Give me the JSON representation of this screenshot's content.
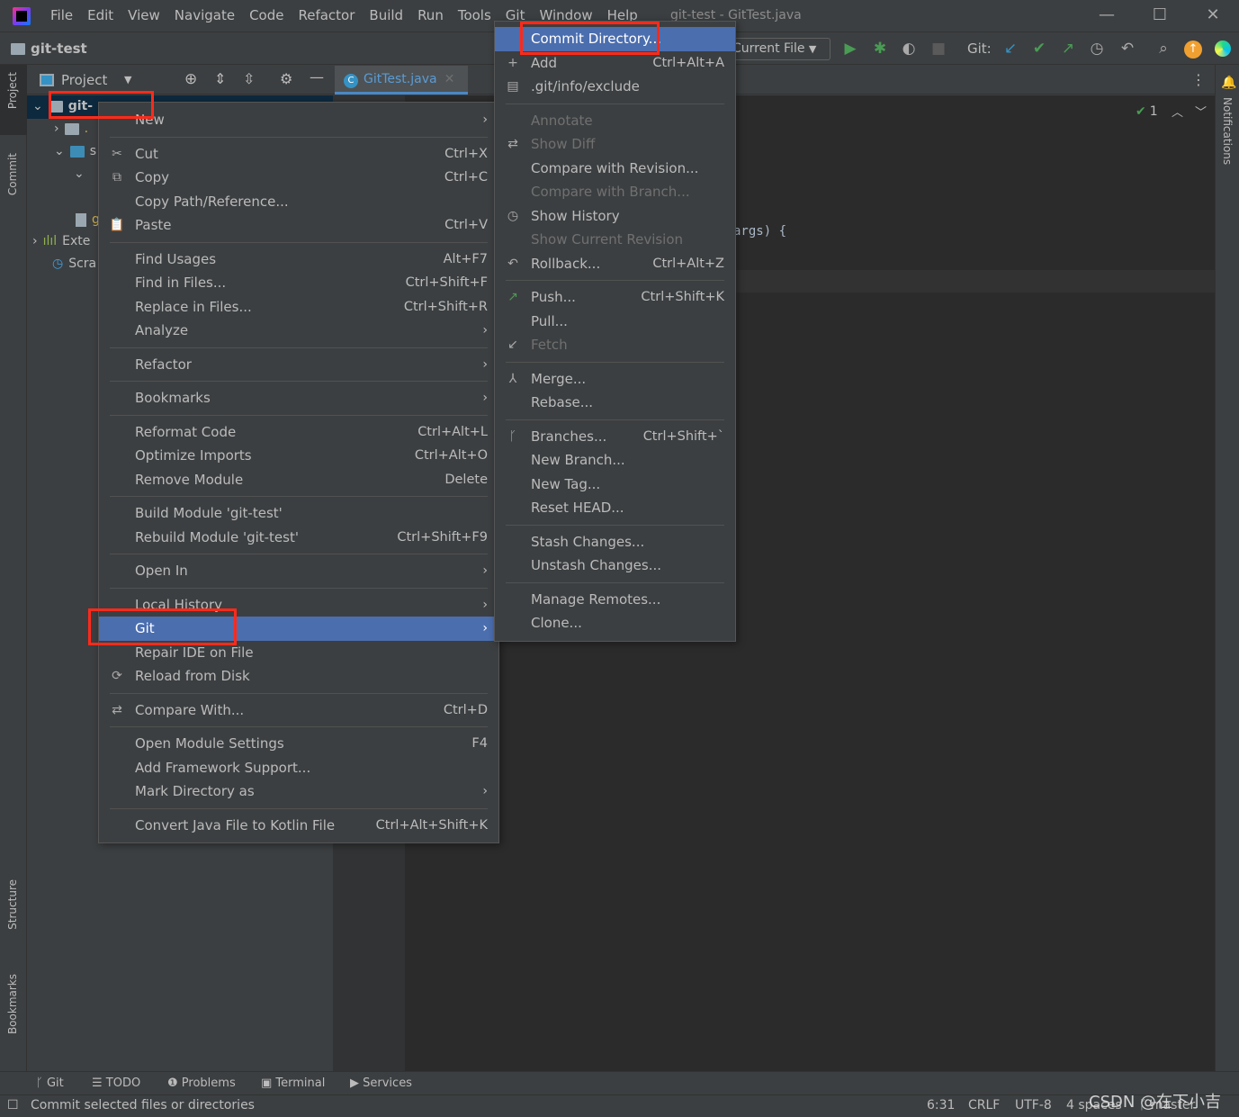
{
  "titlebar": {
    "menus": [
      "File",
      "Edit",
      "View",
      "Navigate",
      "Code",
      "Refactor",
      "Build",
      "Run",
      "Tools",
      "Git",
      "Window",
      "Help"
    ],
    "title": "git-test - GitTest.java"
  },
  "navbar": {
    "project": "git-test",
    "run_config": "Current File",
    "git_label": "Git:"
  },
  "left_strip": {
    "project": "Project",
    "commit": "Commit",
    "structure": "Structure",
    "bookmarks": "Bookmarks"
  },
  "right_strip": {
    "notifications": "Notifications"
  },
  "project_panel": {
    "title": "Project",
    "tree": [
      {
        "label": "git-"
      },
      {
        "label": "."
      },
      {
        "label": "s"
      },
      {
        "label": ""
      },
      {
        "label": "g"
      },
      {
        "label": "Exte"
      },
      {
        "label": "Scra"
      }
    ]
  },
  "editor": {
    "tab": "GitTest.java",
    "code_fragment": "args) {",
    "inspection_count": "1"
  },
  "context_menu": [
    {
      "label": "New",
      "arrow": true
    },
    {
      "sep": true
    },
    {
      "label": "Cut",
      "shortcut": "Ctrl+X",
      "icon": "✂",
      "iconName": "scissors-icon"
    },
    {
      "label": "Copy",
      "shortcut": "Ctrl+C",
      "icon": "⧉",
      "iconName": "copy-icon"
    },
    {
      "label": "Copy Path/Reference..."
    },
    {
      "label": "Paste",
      "shortcut": "Ctrl+V",
      "icon": "📋",
      "iconName": "clipboard-icon"
    },
    {
      "sep": true
    },
    {
      "label": "Find Usages",
      "shortcut": "Alt+F7"
    },
    {
      "label": "Find in Files...",
      "shortcut": "Ctrl+Shift+F"
    },
    {
      "label": "Replace in Files...",
      "shortcut": "Ctrl+Shift+R"
    },
    {
      "label": "Analyze",
      "arrow": true
    },
    {
      "sep": true
    },
    {
      "label": "Refactor",
      "arrow": true
    },
    {
      "sep": true
    },
    {
      "label": "Bookmarks",
      "arrow": true
    },
    {
      "sep": true
    },
    {
      "label": "Reformat Code",
      "shortcut": "Ctrl+Alt+L"
    },
    {
      "label": "Optimize Imports",
      "shortcut": "Ctrl+Alt+O"
    },
    {
      "label": "Remove Module",
      "shortcut": "Delete"
    },
    {
      "sep": true
    },
    {
      "label": "Build Module 'git-test'"
    },
    {
      "label": "Rebuild Module 'git-test'",
      "shortcut": "Ctrl+Shift+F9"
    },
    {
      "sep": true
    },
    {
      "label": "Open In",
      "arrow": true
    },
    {
      "sep": true
    },
    {
      "label": "Local History",
      "arrow": true
    },
    {
      "label": "Git",
      "arrow": true,
      "selected": true
    },
    {
      "label": "Repair IDE on File"
    },
    {
      "label": "Reload from Disk",
      "icon": "⟳",
      "iconName": "reload-icon"
    },
    {
      "sep": true
    },
    {
      "label": "Compare With...",
      "shortcut": "Ctrl+D",
      "icon": "⇄",
      "iconName": "compare-icon"
    },
    {
      "sep": true
    },
    {
      "label": "Open Module Settings",
      "shortcut": "F4"
    },
    {
      "label": "Add Framework Support..."
    },
    {
      "label": "Mark Directory as",
      "arrow": true
    },
    {
      "sep": true
    },
    {
      "label": "Convert Java File to Kotlin File",
      "shortcut": "Ctrl+Alt+Shift+K"
    }
  ],
  "git_menu": [
    {
      "label": "Commit Directory...",
      "selected": true
    },
    {
      "label": "Add",
      "shortcut": "Ctrl+Alt+A",
      "icon": "+",
      "iconName": "plus-icon"
    },
    {
      "label": ".git/info/exclude",
      "icon": "▤",
      "iconName": "exclude-file-icon"
    },
    {
      "sep": true
    },
    {
      "label": "Annotate",
      "disabled": true
    },
    {
      "label": "Show Diff",
      "disabled": true,
      "icon": "⇄",
      "iconName": "diff-icon"
    },
    {
      "label": "Compare with Revision..."
    },
    {
      "label": "Compare with Branch...",
      "disabled": true
    },
    {
      "label": "Show History",
      "icon": "◷",
      "iconName": "clock-icon"
    },
    {
      "label": "Show Current Revision",
      "disabled": true
    },
    {
      "label": "Rollback...",
      "shortcut": "Ctrl+Alt+Z",
      "icon": "↶",
      "iconName": "rollback-icon"
    },
    {
      "sep": true
    },
    {
      "label": "Push...",
      "shortcut": "Ctrl+Shift+K",
      "icon": "↗",
      "iconName": "push-icon",
      "iconColor": "#499c54"
    },
    {
      "label": "Pull..."
    },
    {
      "label": "Fetch",
      "disabled": true,
      "icon": "↙",
      "iconName": "fetch-icon"
    },
    {
      "sep": true
    },
    {
      "label": "Merge...",
      "icon": "⅄",
      "iconName": "merge-icon"
    },
    {
      "label": "Rebase..."
    },
    {
      "sep": true
    },
    {
      "label": "Branches...",
      "shortcut": "Ctrl+Shift+`",
      "icon": "ᚴ",
      "iconName": "branch-icon"
    },
    {
      "label": "New Branch..."
    },
    {
      "label": "New Tag..."
    },
    {
      "label": "Reset HEAD..."
    },
    {
      "sep": true
    },
    {
      "label": "Stash Changes..."
    },
    {
      "label": "Unstash Changes..."
    },
    {
      "sep": true
    },
    {
      "label": "Manage Remotes..."
    },
    {
      "label": "Clone..."
    }
  ],
  "bottom_tools": [
    "Git",
    "TODO",
    "Problems",
    "Terminal",
    "Services"
  ],
  "status": {
    "message": "Commit selected files or directories",
    "position": "6:31",
    "line_sep": "CRLF",
    "encoding": "UTF-8",
    "indent": "4 spaces",
    "branch": "master"
  },
  "watermark": "CSDN @在下小吉",
  "colors": {
    "selection": "#4b6eaf",
    "highlight_box": "#ff2a1a",
    "editor_bg": "#2b2b2b",
    "panel_bg": "#3c3f41"
  }
}
